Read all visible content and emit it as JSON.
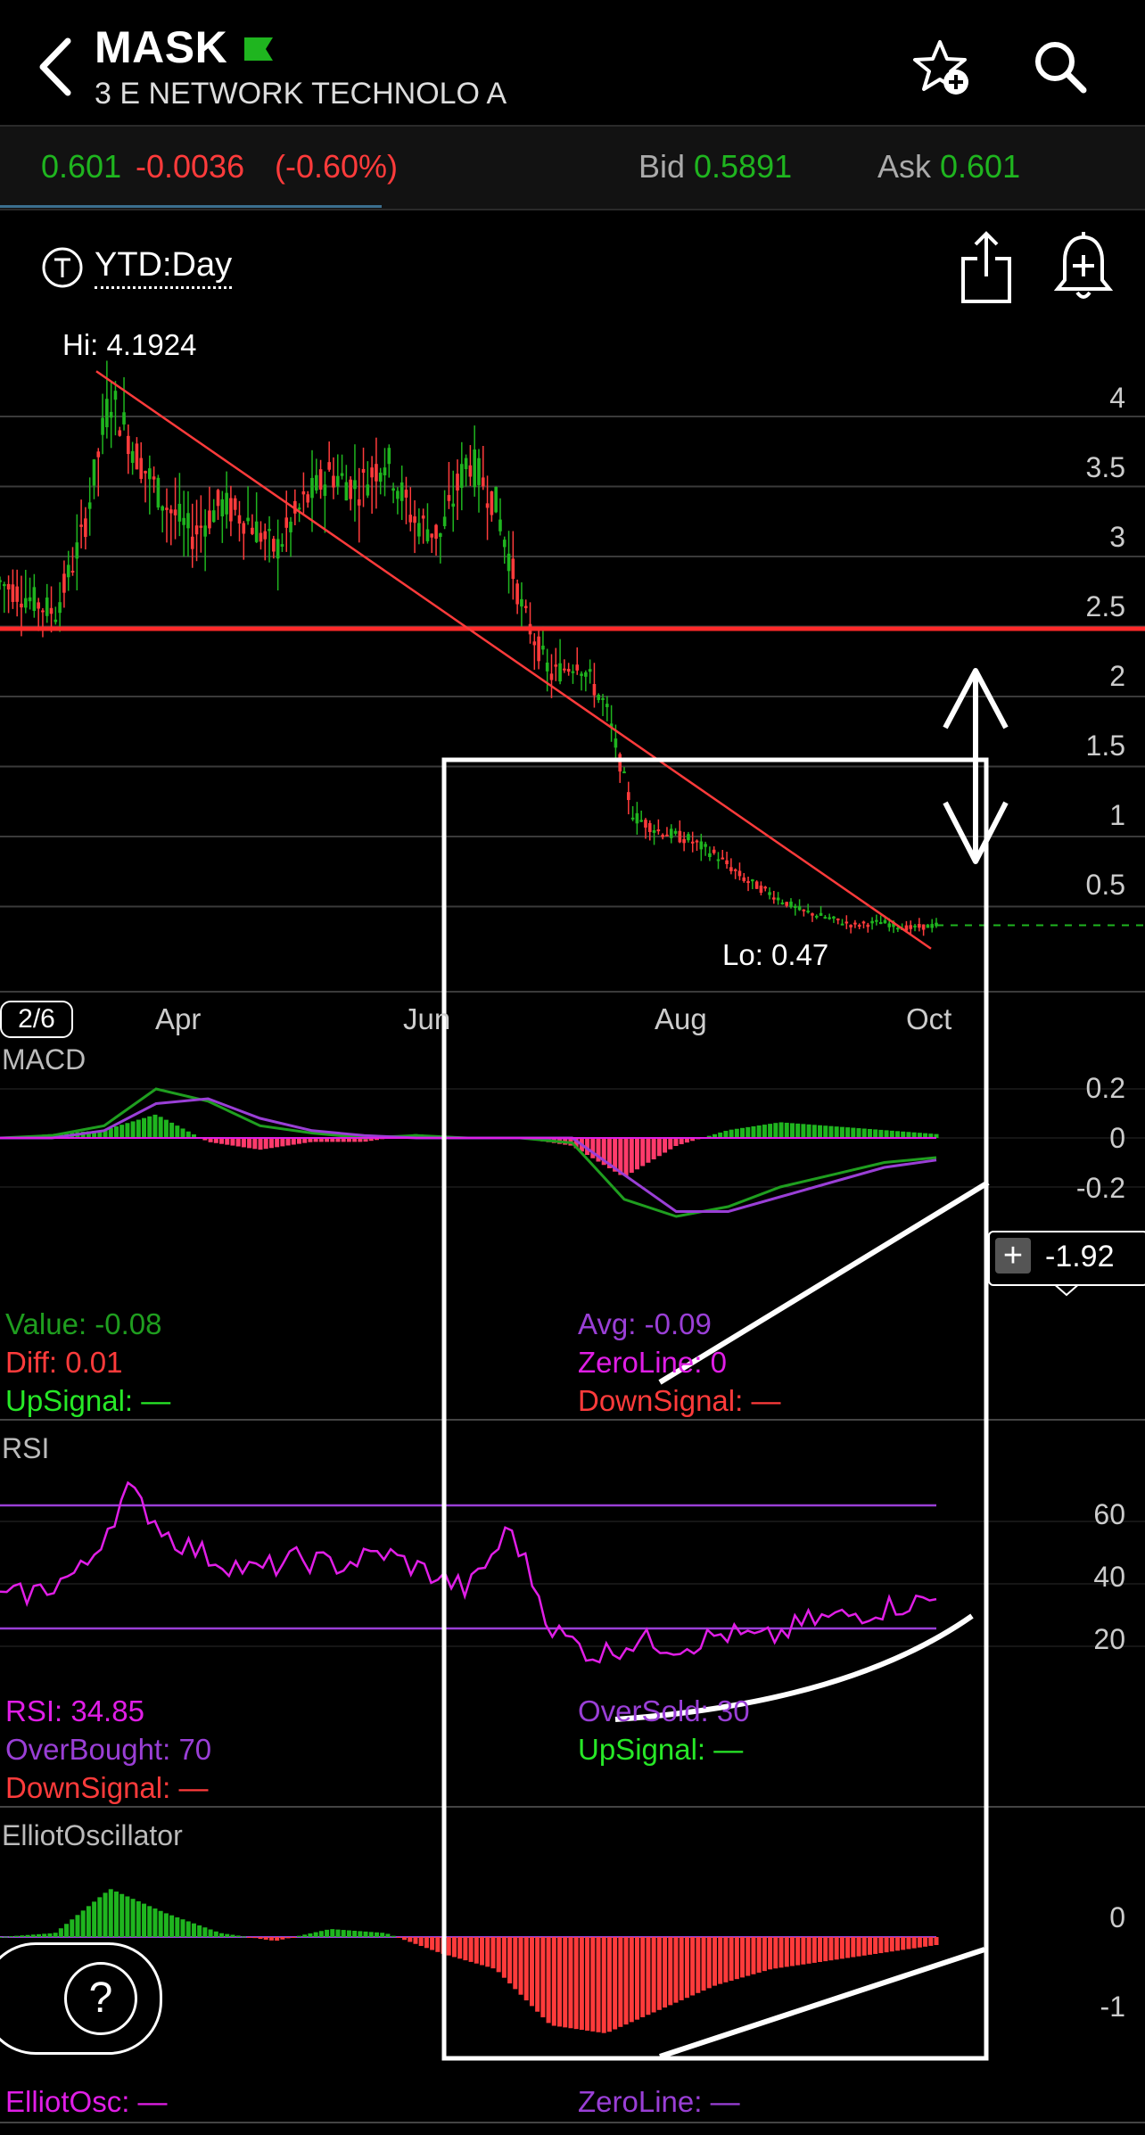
{
  "header": {
    "symbol": "MASK",
    "company": "3 E NETWORK TECHNOLO A",
    "flag_color": "#1fb51f"
  },
  "icons": {
    "back": "chevron-left-icon",
    "watchlist": "star-plus-icon",
    "search": "search-icon",
    "share": "share-icon",
    "alert": "bell-plus-icon",
    "help": "question-icon",
    "period": "clock-t-icon"
  },
  "quote": {
    "last": "0.601",
    "change": "-0.0036",
    "change_pct": "(-0.60%)",
    "bid_label": "Bid",
    "bid": "0.5891",
    "ask_label": "Ask",
    "ask": "0.601"
  },
  "chart_header": {
    "period": "YTD:Day"
  },
  "price_chart": {
    "hi_label": "Hi: 4.1924",
    "lo_label": "Lo: 0.47",
    "y_ticks": [
      "4",
      "3.5",
      "3",
      "2.5",
      "2",
      "1.5",
      "1",
      "0.5"
    ],
    "x_ticks": [
      "Apr",
      "Jun",
      "Aug",
      "Oct"
    ],
    "page_badge": "2/6"
  },
  "macd": {
    "title": "MACD",
    "y_ticks": [
      "0.2",
      "0",
      "-0.2"
    ],
    "value": "Value: -0.08",
    "diff": "Diff: 0.01",
    "upsignal": "UpSignal: —",
    "avg": "Avg: -0.09",
    "zeroline": "ZeroLine: 0",
    "downsignal": "DownSignal: —",
    "tag_value": "-1.92"
  },
  "rsi": {
    "title": "RSI",
    "y_ticks": [
      "60",
      "40",
      "20"
    ],
    "rsi": "RSI: 34.85",
    "overbought": "OverBought: 70",
    "downsignal": "DownSignal: —",
    "oversold": "OverSold: 30",
    "upsignal": "UpSignal: —"
  },
  "elliot": {
    "title": "ElliotOscillator",
    "y_ticks": [
      "0",
      "-1"
    ],
    "elliotosc": "ElliotOsc: —",
    "zeroline": "ZeroLine: —"
  },
  "colors": {
    "up": "#1fb51f",
    "down": "#ff3b3b",
    "macd_value": "#1f9e1f",
    "macd_avg": "#9a3fd6",
    "rsi": "#e01ee6",
    "grid": "#444444"
  },
  "chart_data": [
    {
      "type": "line",
      "title": "",
      "x_ticks": [
        "Apr",
        "Jun",
        "Aug",
        "Oct"
      ],
      "ylim": [
        0.3,
        4.3
      ],
      "series": [
        {
          "values": [
            2.8,
            2.7,
            2.6,
            3.1,
            4.0,
            3.6,
            3.3,
            3.1,
            3.3,
            3.2,
            3.0,
            3.3,
            3.5,
            3.4,
            3.6,
            3.2,
            3.1,
            3.6,
            3.3,
            2.6,
            2.2,
            2.3,
            2.0,
            1.3,
            1.2,
            1.15,
            1.05,
            0.9,
            0.8,
            0.7,
            0.65,
            0.6,
            0.62,
            0.58,
            0.6
          ]
        }
      ],
      "annotations": [
        "Hi: 4.1924",
        "Lo: 0.47"
      ],
      "horizontal_line": 2.5
    },
    {
      "type": "line",
      "title": "MACD",
      "ylim": [
        -0.35,
        0.3
      ],
      "series": [
        {
          "values": [
            0.0,
            0.01,
            0.05,
            0.2,
            0.15,
            0.05,
            0.02,
            0.0,
            0.01,
            0.0,
            0.0,
            -0.02,
            -0.25,
            -0.32,
            -0.28,
            -0.2,
            -0.15,
            -0.1,
            -0.08
          ]
        },
        {
          "values": [
            0.0,
            0.0,
            0.03,
            0.14,
            0.16,
            0.08,
            0.03,
            0.01,
            0.0,
            0.0,
            0.0,
            0.0,
            -0.15,
            -0.3,
            -0.3,
            -0.24,
            -0.18,
            -0.12,
            -0.09
          ]
        }
      ]
    },
    {
      "type": "line",
      "title": "RSI",
      "ylim": [
        0,
        80
      ],
      "series": [
        {
          "values": [
            35,
            38,
            45,
            70,
            55,
            48,
            44,
            48,
            46,
            50,
            44,
            38,
            58,
            25,
            17,
            22,
            20,
            24,
            22,
            28,
            30,
            33,
            35
          ]
        }
      ]
    },
    {
      "type": "bar",
      "title": "ElliotOscillator",
      "ylim": [
        -1.3,
        0.8
      ],
      "values": [
        0.0,
        0.05,
        0.6,
        0.3,
        0.05,
        -0.05,
        0.1,
        0.05,
        -0.2,
        -0.4,
        -1.1,
        -1.2,
        -0.9,
        -0.6,
        -0.4,
        -0.3,
        -0.2,
        -0.1
      ]
    }
  ]
}
